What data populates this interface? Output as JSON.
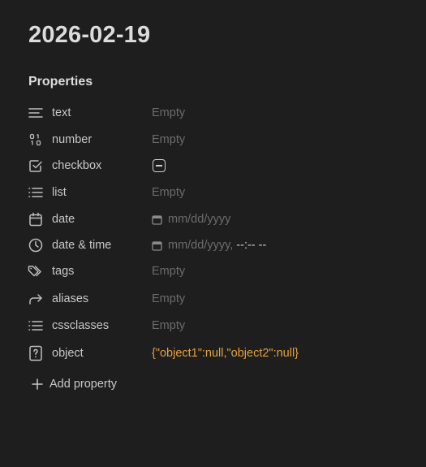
{
  "note": {
    "title": "2026-02-19"
  },
  "properties": {
    "heading": "Properties",
    "items": [
      {
        "name": "text",
        "icon": "text-lines-icon",
        "value": "Empty",
        "kind": "empty"
      },
      {
        "name": "number",
        "icon": "number-icon",
        "value": "Empty",
        "kind": "empty"
      },
      {
        "name": "checkbox",
        "icon": "checkbox-icon",
        "value": "",
        "kind": "checkbox",
        "checked_state": "indeterminate"
      },
      {
        "name": "list",
        "icon": "list-icon",
        "value": "Empty",
        "kind": "empty"
      },
      {
        "name": "date",
        "icon": "calendar-icon",
        "value": "mm/dd/yyyy",
        "kind": "date"
      },
      {
        "name": "date & time",
        "icon": "clock-icon",
        "value": "mm/dd/yyyy,",
        "time_value": "--:-- --",
        "kind": "datetime"
      },
      {
        "name": "tags",
        "icon": "tags-icon",
        "value": "Empty",
        "kind": "empty"
      },
      {
        "name": "aliases",
        "icon": "forward-arrow-icon",
        "value": "Empty",
        "kind": "empty"
      },
      {
        "name": "cssclasses",
        "icon": "list-icon",
        "value": "Empty",
        "kind": "empty"
      },
      {
        "name": "object",
        "icon": "unknown-type-icon",
        "value": "{\"object1\":null,\"object2\":null}",
        "kind": "json"
      }
    ],
    "add_label": "Add property"
  },
  "colors": {
    "background": "#1e1e1e",
    "text": "#dadada",
    "muted": "#6c6c6c",
    "json_value": "#e5a03f"
  }
}
